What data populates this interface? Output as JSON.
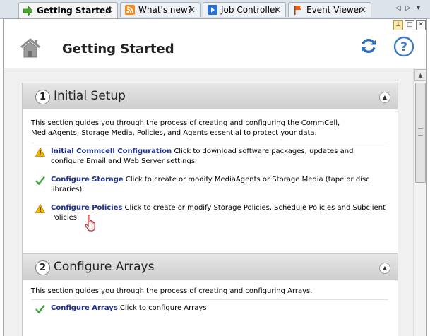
{
  "tabs": [
    {
      "label": "Getting Started",
      "active": true,
      "icon": "arrow-right-icon"
    },
    {
      "label": "What's new?",
      "active": false,
      "icon": "rss-icon"
    },
    {
      "label": "Job Controller",
      "active": false,
      "icon": "play-icon"
    },
    {
      "label": "Event Viewer",
      "active": false,
      "icon": "flag-icon"
    }
  ],
  "tab_close_glyph": "✕",
  "header": {
    "title": "Getting Started"
  },
  "sections": [
    {
      "number": "1",
      "title": "Initial Setup",
      "description": "This section guides you through the process of creating and configuring the CommCell, MediaAgents, Storage Media, Policies, and Agents essential to protect your data.",
      "items": [
        {
          "status": "warning",
          "link": "Initial Commcell Configuration",
          "text": "Click to download software packages, updates and configure Email and Web Server settings."
        },
        {
          "status": "done",
          "link": "Configure Storage",
          "text": "Click to create or modify MediaAgents or Storage Media (tape or disc libraries)."
        },
        {
          "status": "warning",
          "link": "Configure Policies",
          "text": "Click to create or modify Storage Policies, Schedule Policies and Subclient Policies."
        }
      ]
    },
    {
      "number": "2",
      "title": "Configure Arrays",
      "description": "This section guides you through the process of creating and configuring Arrays.",
      "items": [
        {
          "status": "done",
          "link": "Configure Arrays",
          "text": "Click to configure Arrays"
        }
      ]
    }
  ],
  "colors": {
    "link": "#1c2f8f",
    "warning": "#f0b400",
    "done": "#3aa63a",
    "refresh": "#2a6fc0"
  }
}
